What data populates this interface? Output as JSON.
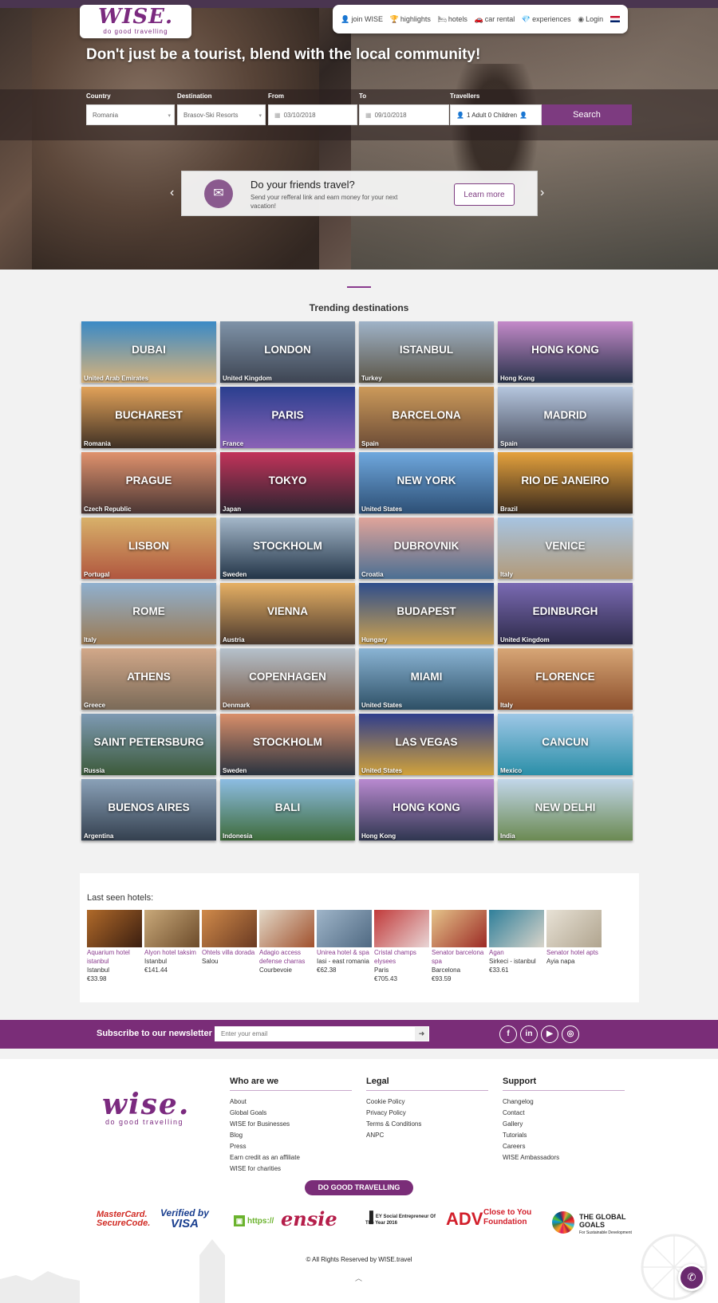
{
  "header": {
    "logo": "WISE.",
    "logo_tagline": "do good travelling",
    "nav": [
      {
        "label": "join WISE",
        "icon": "user-plus-icon",
        "glyph": "👤"
      },
      {
        "label": "highlights",
        "icon": "trophy-icon",
        "glyph": "🏆"
      },
      {
        "label": "hotels",
        "icon": "bed-icon",
        "glyph": "🛏"
      },
      {
        "label": "car rental",
        "icon": "car-icon",
        "glyph": "🚗"
      },
      {
        "label": "experiences",
        "icon": "diamond-icon",
        "glyph": "💎"
      },
      {
        "label": "Login",
        "icon": "user-circle-icon",
        "glyph": "◉"
      }
    ],
    "language_icon": "uk-flag-icon"
  },
  "hero": {
    "title": "Don't just be a tourist, blend with the local community!"
  },
  "search": {
    "country_label": "Country",
    "country_value": "Romania",
    "destination_label": "Destination",
    "destination_value": "Brasov-Ski Resorts",
    "from_label": "From",
    "from_value": "03/10/2018",
    "to_label": "To",
    "to_value": "09/10/2018",
    "travellers_label": "Travellers",
    "travellers_value": "1 Adult 0 Children",
    "button": "Search"
  },
  "promo": {
    "title": "Do your friends travel?",
    "text": "Send your refferal link and earn money for your next vacation!",
    "button": "Learn more"
  },
  "trending": {
    "title": "Trending destinations",
    "tiles": [
      {
        "city": "DUBAI",
        "country": "United Arab Emirates",
        "c1": "#3b8ac6",
        "c2": "#d7b27a"
      },
      {
        "city": "LONDON",
        "country": "United Kingdom",
        "c1": "#7f93a8",
        "c2": "#3d4452"
      },
      {
        "city": "ISTANBUL",
        "country": "Turkey",
        "c1": "#9fb3c8",
        "c2": "#5c5648"
      },
      {
        "city": "HONG KONG",
        "country": "Hong Kong",
        "c1": "#c48ac9",
        "c2": "#27324a"
      },
      {
        "city": "BUCHAREST",
        "country": "Romania",
        "c1": "#e2a259",
        "c2": "#3e3024"
      },
      {
        "city": "PARIS",
        "country": "France",
        "c1": "#2a3f8f",
        "c2": "#8a62b6"
      },
      {
        "city": "BARCELONA",
        "country": "Spain",
        "c1": "#cc9a5a",
        "c2": "#6b4b36"
      },
      {
        "city": "MADRID",
        "country": "Spain",
        "c1": "#b5c6de",
        "c2": "#4c5162"
      },
      {
        "city": "PRAGUE",
        "country": "Czech Republic",
        "c1": "#e0926d",
        "c2": "#4a3634"
      },
      {
        "city": "TOKYO",
        "country": "Japan",
        "c1": "#c2335a",
        "c2": "#2b2430"
      },
      {
        "city": "NEW YORK",
        "country": "United States",
        "c1": "#6fa8de",
        "c2": "#2d4f75"
      },
      {
        "city": "RIO DE JANEIRO",
        "country": "Brazil",
        "c1": "#e5a23d",
        "c2": "#3a2a1c"
      },
      {
        "city": "LISBON",
        "country": "Portugal",
        "c1": "#d8b16a",
        "c2": "#b0563f"
      },
      {
        "city": "STOCKHOLM",
        "country": "Sweden",
        "c1": "#a4b7c9",
        "c2": "#233548"
      },
      {
        "city": "DUBROVNIK",
        "country": "Croatia",
        "c1": "#e0a49a",
        "c2": "#4b6f93"
      },
      {
        "city": "VENICE",
        "country": "Italy",
        "c1": "#a7c4e1",
        "c2": "#b39a78"
      },
      {
        "city": "ROME",
        "country": "Italy",
        "c1": "#8fb0cf",
        "c2": "#9c7b54"
      },
      {
        "city": "VIENNA",
        "country": "Austria",
        "c1": "#e6b064",
        "c2": "#4c3a2e"
      },
      {
        "city": "BUDAPEST",
        "country": "Hungary",
        "c1": "#2f4e8c",
        "c2": "#caa04f"
      },
      {
        "city": "EDINBURGH",
        "country": "United Kingdom",
        "c1": "#7a6ab3",
        "c2": "#2e2b4a"
      },
      {
        "city": "ATHENS",
        "country": "Greece",
        "c1": "#d2a889",
        "c2": "#7a6a58"
      },
      {
        "city": "COPENHAGEN",
        "country": "Denmark",
        "c1": "#b5c1cc",
        "c2": "#7a5a45"
      },
      {
        "city": "MIAMI",
        "country": "United States",
        "c1": "#8ab4d4",
        "c2": "#2e5066"
      },
      {
        "city": "FLORENCE",
        "country": "Italy",
        "c1": "#d7a676",
        "c2": "#8c4f2c"
      },
      {
        "city": "SAINT PETERSBURG",
        "country": "Russia",
        "c1": "#7e9ab4",
        "c2": "#3c5a3a"
      },
      {
        "city": "STOCKHOLM",
        "country": "Sweden",
        "c1": "#d98f6a",
        "c2": "#2a3340"
      },
      {
        "city": "LAS VEGAS",
        "country": "United States",
        "c1": "#2f3d8c",
        "c2": "#d1a23b"
      },
      {
        "city": "CANCUN",
        "country": "Mexico",
        "c1": "#9ec7e6",
        "c2": "#2b8fa8"
      },
      {
        "city": "BUENOS AIRES",
        "country": "Argentina",
        "c1": "#8aa1b8",
        "c2": "#34404f"
      },
      {
        "city": "BALI",
        "country": "Indonesia",
        "c1": "#8dbde3",
        "c2": "#3e6b3a"
      },
      {
        "city": "HONG KONG",
        "country": "Hong Kong",
        "c1": "#b98ad0",
        "c2": "#2f3650"
      },
      {
        "city": "NEW DELHI",
        "country": "India",
        "c1": "#c2d7ea",
        "c2": "#6b8a52"
      }
    ]
  },
  "last_seen": {
    "title": "Last seen hotels:",
    "hotels": [
      {
        "name": "Aquarium hotel istanbul",
        "city": "Istanbul",
        "price": "€33.98",
        "c1": "#b06a2a",
        "c2": "#3b1e10"
      },
      {
        "name": "Alyon hotel taksim",
        "city": "Istanbul",
        "price": "€141.44",
        "c1": "#c9a97a",
        "c2": "#6c4b2a"
      },
      {
        "name": "Ohtels villa dorada",
        "city": "Salou",
        "price": "",
        "c1": "#d08a4a",
        "c2": "#6a3a22"
      },
      {
        "name": "Adagio access defense charras",
        "city": "Courbevoie",
        "price": "",
        "c1": "#e3d9c8",
        "c2": "#a0502c"
      },
      {
        "name": "Unirea hotel & spa",
        "city": "Iasi - east romania",
        "price": "€62.38",
        "c1": "#9fb5c9",
        "c2": "#4f6982"
      },
      {
        "name": "Cristal champs elysees",
        "city": "Paris",
        "price": "€705.43",
        "c1": "#c13a3a",
        "c2": "#e9d6d6"
      },
      {
        "name": "Senator barcelona spa",
        "city": "Barcelona",
        "price": "€93.59",
        "c1": "#e5c48a",
        "c2": "#9c2a25"
      },
      {
        "name": "Agan",
        "city": "Sirkeci - istanbul",
        "price": "€33.61",
        "c1": "#2f7f9a",
        "c2": "#d9d4ca"
      },
      {
        "name": "Senator hotel apts",
        "city": "Ayia napa",
        "price": "",
        "c1": "#e8e2d6",
        "c2": "#b0a48e"
      }
    ]
  },
  "newsletter": {
    "label": "Subscribe to our newsletter",
    "placeholder": "Enter your email",
    "social": [
      {
        "name": "facebook-icon",
        "glyph": "f"
      },
      {
        "name": "linkedin-icon",
        "glyph": "in"
      },
      {
        "name": "youtube-icon",
        "glyph": "▶"
      },
      {
        "name": "instagram-icon",
        "glyph": "◎"
      }
    ]
  },
  "footer": {
    "logo": "wise.",
    "logo_tagline": "do good travelling",
    "columns": [
      {
        "title": "Who are we",
        "links": [
          "About",
          "Global Goals",
          "WISE for Businesses",
          "Blog",
          "Press",
          "Earn credit as an affiliate",
          "WISE for charities"
        ]
      },
      {
        "title": "Legal",
        "links": [
          "Cookie Policy",
          "Privacy Policy",
          "Terms & Conditions",
          "ANPC"
        ]
      },
      {
        "title": "Support",
        "links": [
          "Changelog",
          "Contact",
          "Gallery",
          "Tutorials",
          "Careers",
          "WISE Ambassadors"
        ]
      }
    ],
    "badge": "DO GOOD TRAVELLING",
    "partners": {
      "mastercard": "MasterCard. SecureCode.",
      "visa_top": "Verified by",
      "visa_bottom": "VISA",
      "https": "https://",
      "ensie": "ensie",
      "ey": "EY Social Entrepreneur Of The Year 2016",
      "adv": "ADV",
      "adv_sub": "Close to You Foundation",
      "global_goals": "THE GLOBAL GOALS",
      "global_goals_sub": "For Sustainable Development"
    },
    "copyright": "© All Rights Reserved by WISE.travel"
  },
  "colors": {
    "brand": "#7a2d78",
    "accent": "#8a3b8e"
  }
}
